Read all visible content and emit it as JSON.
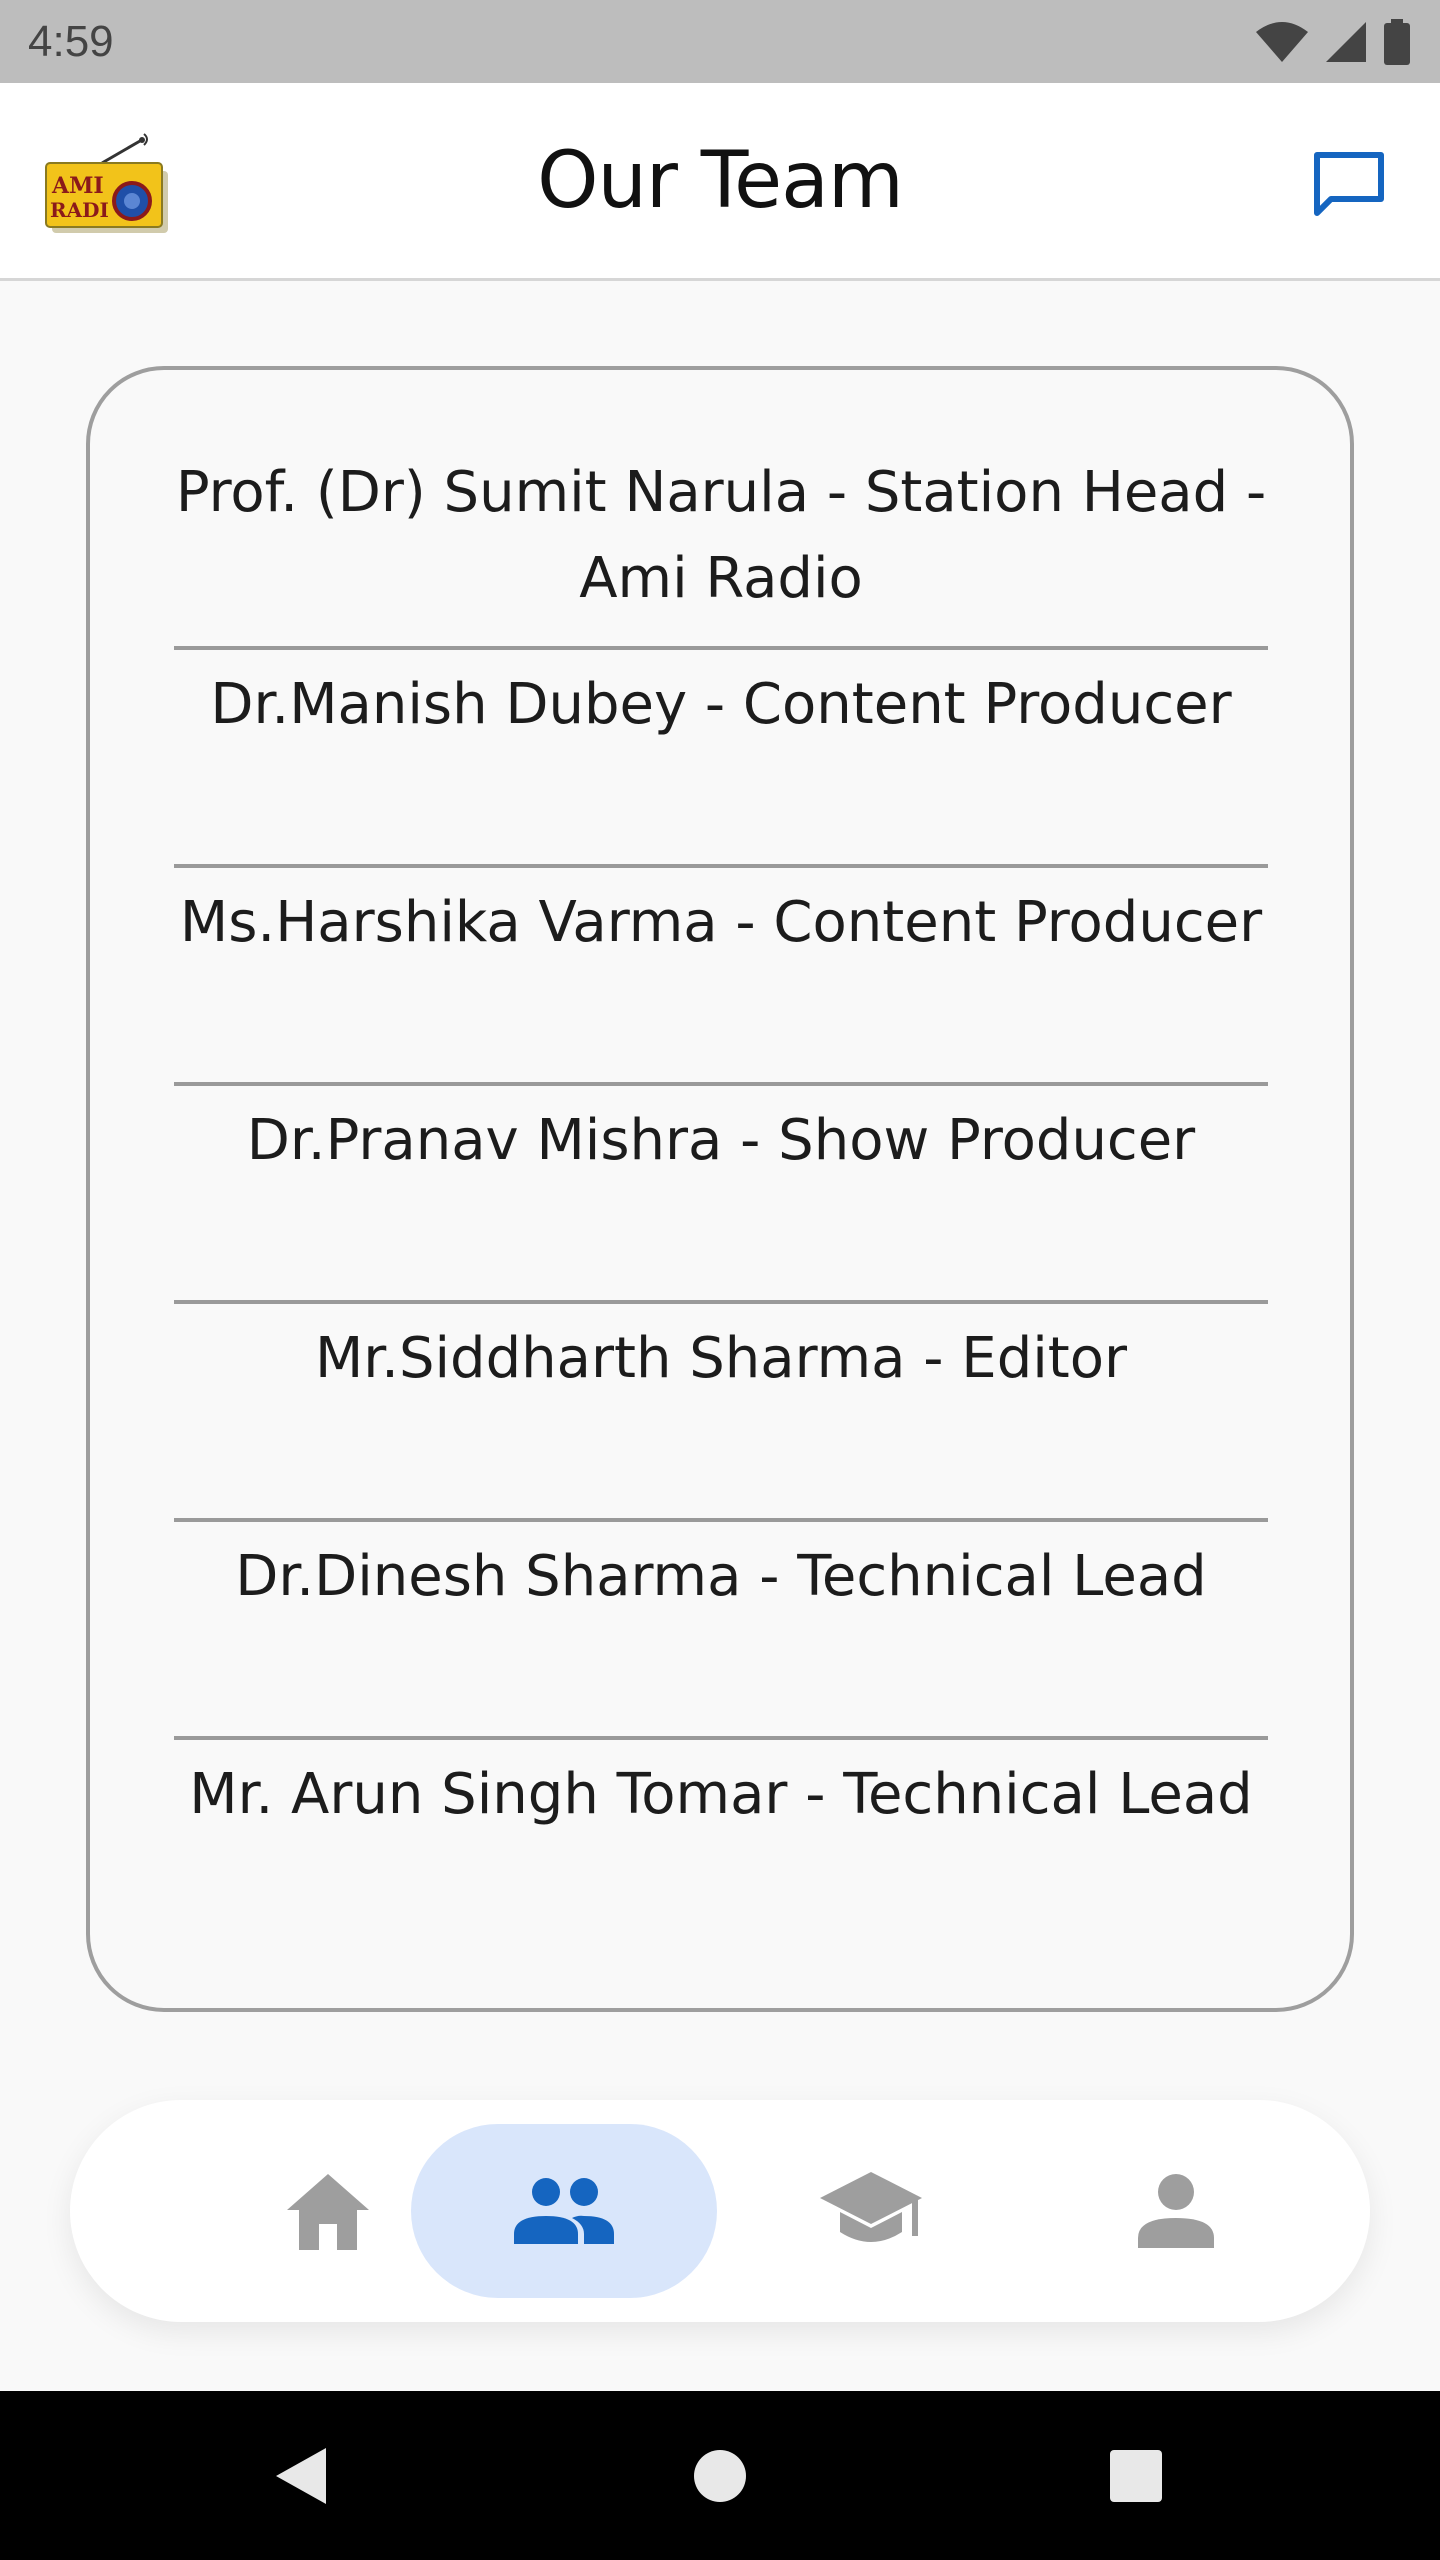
{
  "status_bar": {
    "time": "4:59"
  },
  "app_bar": {
    "title": "Our Team",
    "logo_text": [
      "AMI",
      "RADI"
    ],
    "logo_icon": "ami-radio-logo",
    "action_icon": "chat-bubble-icon"
  },
  "team": {
    "members": [
      {
        "text": "Prof. (Dr) Sumit Narula - Station Head - Ami Radio"
      },
      {
        "text": "Dr.Manish Dubey - Content Producer"
      },
      {
        "text": "Ms.Harshika Varma - Content Producer"
      },
      {
        "text": "Dr.Pranav Mishra - Show Producer"
      },
      {
        "text": "Mr.Siddharth Sharma - Editor"
      },
      {
        "text": "Dr.Dinesh Sharma - Technical Lead"
      },
      {
        "text": "Mr. Arun Singh Tomar - Technical Lead"
      }
    ]
  },
  "bottom_nav": {
    "items": [
      {
        "icon": "home-icon",
        "active": false
      },
      {
        "icon": "people-icon",
        "active": true
      },
      {
        "icon": "school-icon",
        "active": false
      },
      {
        "icon": "person-icon",
        "active": false
      }
    ]
  },
  "colors": {
    "accent": "#1565c0",
    "nav_active_bg": "#d9e6fb",
    "nav_inactive": "#9e9e9e",
    "card_border": "#9e9e9e",
    "status_bar": "#bdbdbd"
  }
}
